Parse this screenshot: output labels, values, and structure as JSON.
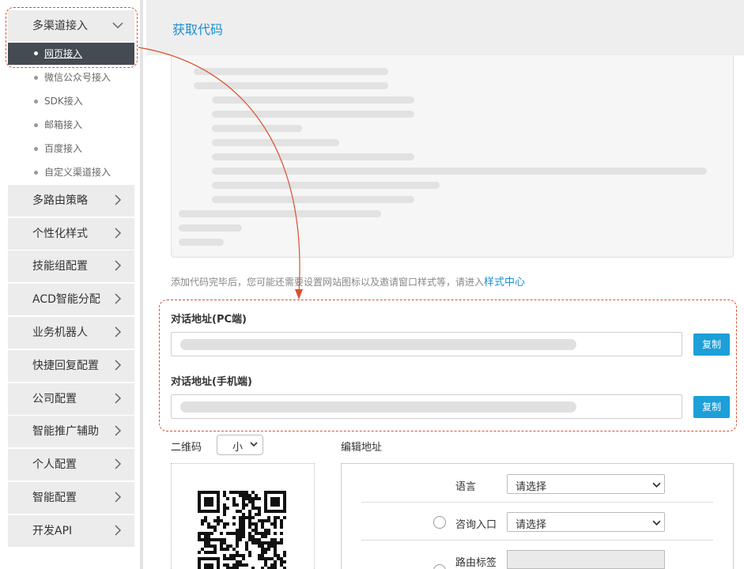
{
  "sidebar": {
    "expanded_group": {
      "label": "多渠道接入",
      "active_item": "网页接入",
      "items": [
        "微信公众号接入",
        "SDK接入",
        "邮箱接入",
        "百度接入",
        "自定义渠道接入"
      ]
    },
    "groups": [
      "多路由策略",
      "个性化样式",
      "技能组配置",
      "ACD智能分配",
      "业务机器人",
      "快捷回复配置",
      "公司配置",
      "智能推广辅助",
      "个人配置",
      "智能配置",
      "开发API"
    ]
  },
  "header": {
    "title": "获取代码"
  },
  "hint": {
    "text": "添加代码完毕后，您可能还需要设置网站图标以及邀请窗口样式等，请进入",
    "link": "样式中心"
  },
  "dialog_urls": {
    "pc_label": "对话地址(PC端)",
    "mobile_label": "对话地址(手机端)",
    "copy_label": "复制"
  },
  "qrcode": {
    "label": "二维码",
    "size_value": "小"
  },
  "edit_address": {
    "label": "编辑地址",
    "language_label": "语言",
    "language_value": "请选择",
    "entry_label": "咨询入口",
    "entry_value": "请选择",
    "route_tag_label": "路由标签"
  },
  "colors": {
    "accent": "#1a8fd0",
    "button": "#1d9fd8",
    "active_bg": "#444b52",
    "annotation": "#d9502f"
  },
  "icons": {
    "group_expanded": "chevron-down-icon",
    "group_collapsed": "chevron-right-icon",
    "select_arrow": "chevron-down-icon"
  }
}
